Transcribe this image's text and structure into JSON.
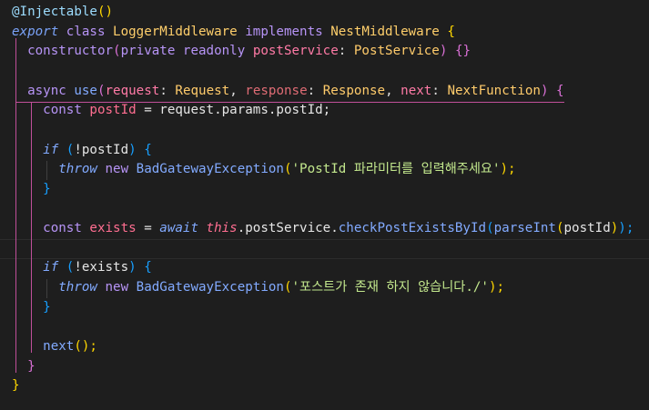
{
  "editor": {
    "language": "typescript",
    "theme_colors": {
      "background": "#1e1e1e",
      "indent_guide_active": "#c04f9a",
      "string": "#c3e88d",
      "class": "#ffcf6b",
      "function": "#82aaff"
    },
    "lines": [
      [
        {
          "t": "@Injectable",
          "c": "c-deco"
        },
        {
          "t": "()",
          "c": "c-paren-y"
        }
      ],
      [
        {
          "t": "export",
          "c": "c-kw"
        },
        {
          "t": " class ",
          "c": "c-kw2"
        },
        {
          "t": "LoggerMiddleware",
          "c": "c-cls"
        },
        {
          "t": " implements ",
          "c": "c-kw2"
        },
        {
          "t": "NestMiddleware",
          "c": "c-cls"
        },
        {
          "t": " {",
          "c": "c-paren-y"
        }
      ],
      [
        {
          "t": "  constructor",
          "c": "c-kw2"
        },
        {
          "t": "(",
          "c": "c-paren-p"
        },
        {
          "t": "private readonly ",
          "c": "c-kw2"
        },
        {
          "t": "postService",
          "c": "c-param"
        },
        {
          "t": ": ",
          "c": "c-punc"
        },
        {
          "t": "PostService",
          "c": "c-type"
        },
        {
          "t": ") ",
          "c": "c-paren-p"
        },
        {
          "t": "{}",
          "c": "c-paren-p"
        }
      ],
      [],
      [
        {
          "t": "  async ",
          "c": "c-kw2"
        },
        {
          "t": "use",
          "c": "c-fn"
        },
        {
          "t": "(",
          "c": "c-paren-p"
        },
        {
          "t": "request",
          "c": "c-param"
        },
        {
          "t": ": ",
          "c": "c-punc"
        },
        {
          "t": "Request",
          "c": "c-type"
        },
        {
          "t": ", ",
          "c": "c-punc"
        },
        {
          "t": "response",
          "c": "c-param-dim"
        },
        {
          "t": ": ",
          "c": "c-punc"
        },
        {
          "t": "Response",
          "c": "c-type"
        },
        {
          "t": ", ",
          "c": "c-punc"
        },
        {
          "t": "next",
          "c": "c-param"
        },
        {
          "t": ": ",
          "c": "c-punc"
        },
        {
          "t": "NextFunction",
          "c": "c-type"
        },
        {
          "t": ") ",
          "c": "c-paren-p"
        },
        {
          "t": "{",
          "c": "c-paren-p"
        }
      ],
      [
        {
          "t": "    const ",
          "c": "c-kw2"
        },
        {
          "t": "postId",
          "c": "c-var"
        },
        {
          "t": " = ",
          "c": "c-punc"
        },
        {
          "t": "request.params.postId;",
          "c": "c-text"
        }
      ],
      [],
      [
        {
          "t": "    if ",
          "c": "c-ctrl"
        },
        {
          "t": "(",
          "c": "c-paren-b"
        },
        {
          "t": "!postId",
          "c": "c-text"
        },
        {
          "t": ") ",
          "c": "c-paren-b"
        },
        {
          "t": "{",
          "c": "c-paren-b"
        }
      ],
      [
        {
          "t": "      throw ",
          "c": "c-ctrl"
        },
        {
          "t": "new ",
          "c": "c-kw2"
        },
        {
          "t": "BadGatewayException",
          "c": "c-fn"
        },
        {
          "t": "(",
          "c": "c-paren-y"
        },
        {
          "t": "'PostId 파라미터를 입력해주세요'",
          "c": "c-str"
        },
        {
          "t": ");",
          "c": "c-paren-y"
        }
      ],
      [
        {
          "t": "    }",
          "c": "c-paren-b"
        }
      ],
      [],
      [
        {
          "t": "    const ",
          "c": "c-kw2"
        },
        {
          "t": "exists",
          "c": "c-var"
        },
        {
          "t": " = ",
          "c": "c-punc"
        },
        {
          "t": "await ",
          "c": "c-ctrl"
        },
        {
          "t": "this",
          "c": "c-this"
        },
        {
          "t": ".postService.",
          "c": "c-text"
        },
        {
          "t": "checkPostExistsById",
          "c": "c-fn"
        },
        {
          "t": "(",
          "c": "c-paren-b"
        },
        {
          "t": "parseInt",
          "c": "c-fn"
        },
        {
          "t": "(",
          "c": "c-paren-y"
        },
        {
          "t": "postId",
          "c": "c-text"
        },
        {
          "t": ")",
          "c": "c-paren-y"
        },
        {
          "t": ");",
          "c": "c-paren-b"
        }
      ],
      [],
      [
        {
          "t": "    if ",
          "c": "c-ctrl"
        },
        {
          "t": "(",
          "c": "c-paren-b"
        },
        {
          "t": "!exists",
          "c": "c-text"
        },
        {
          "t": ") ",
          "c": "c-paren-b"
        },
        {
          "t": "{",
          "c": "c-paren-b"
        }
      ],
      [
        {
          "t": "      throw ",
          "c": "c-ctrl"
        },
        {
          "t": "new ",
          "c": "c-kw2"
        },
        {
          "t": "BadGatewayException",
          "c": "c-fn"
        },
        {
          "t": "(",
          "c": "c-paren-y"
        },
        {
          "t": "'포스트가 존재 하지 않습니다./'",
          "c": "c-str"
        },
        {
          "t": ");",
          "c": "c-paren-y"
        }
      ],
      [
        {
          "t": "    }",
          "c": "c-paren-b"
        }
      ],
      [],
      [
        {
          "t": "    next",
          "c": "c-fn"
        },
        {
          "t": "();",
          "c": "c-paren-y"
        }
      ],
      [
        {
          "t": "  }",
          "c": "c-paren-p"
        }
      ],
      [
        {
          "t": "}",
          "c": "c-paren-y"
        }
      ]
    ]
  }
}
